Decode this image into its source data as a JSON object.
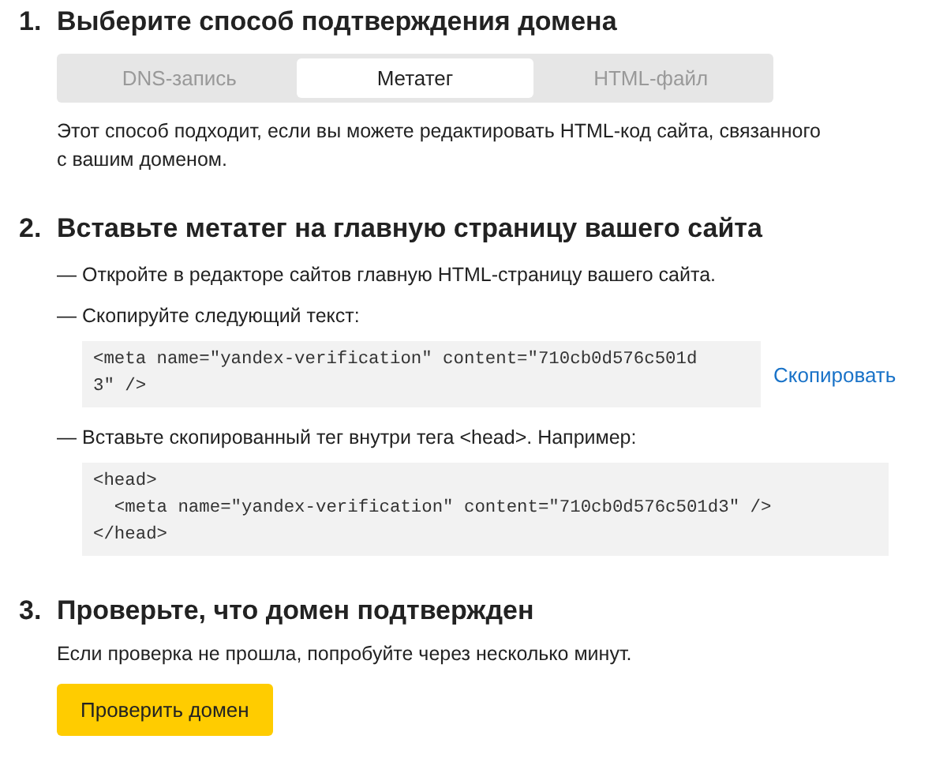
{
  "step1": {
    "number": "1.",
    "title": "Выберите способ подтверждения домена",
    "tabs": [
      {
        "label": "DNS-запись",
        "selected": false
      },
      {
        "label": "Метатег",
        "selected": true
      },
      {
        "label": "HTML-файл",
        "selected": false
      }
    ],
    "description": "Этот способ подходит, если вы можете редактировать HTML-код сайта, связанного с вашим доменом."
  },
  "step2": {
    "number": "2.",
    "title": "Вставьте метатег на главную страницу вашего сайта",
    "items": [
      {
        "dash": "—",
        "text": "Откройте в редакторе сайтов главную HTML-страницу вашего сайта."
      },
      {
        "dash": "—",
        "text": "Скопируйте следующий текст:",
        "code": [
          "<meta name=\"yandex-verification\" content=\"710cb0d576c501d",
          "3\" />"
        ],
        "link": "Скопировать"
      },
      {
        "dash": "—",
        "text": "Вставьте скопированный тег внутри тега <head>. Например:",
        "code": [
          "<head>",
          "  <meta name=\"yandex-verification\" content=\"710cb0d576c501d3\" />",
          "</head>"
        ]
      }
    ]
  },
  "step3": {
    "number": "3.",
    "title": "Проверьте, что домен подтвержден",
    "description": "Если проверка не прошла, попробуйте через несколько минут.",
    "button": "Проверить домен"
  }
}
